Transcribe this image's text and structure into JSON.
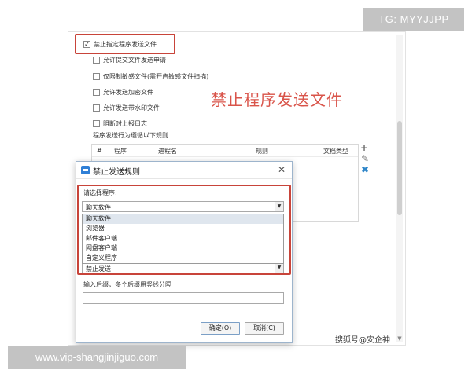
{
  "watermarks": {
    "tg": "TG: MYYJJPP",
    "site": "www.vip-shangjinjiguo.com",
    "source": "搜狐号@安企神"
  },
  "settings": {
    "main_checkbox": {
      "label": "禁止指定程序发送文件",
      "checked": true
    },
    "options": [
      {
        "label": "允许提交文件发送申请",
        "checked": false
      },
      {
        "label": "仅限制敏感文件(需开启敏感文件扫描)",
        "checked": false
      },
      {
        "label": "允许发送加密文件",
        "checked": false
      },
      {
        "label": "允许发送带水印文件",
        "checked": false
      },
      {
        "label": "阻断时上报日志",
        "checked": false
      }
    ],
    "rules_caption": "程序发送行为遵循以下规则",
    "table_headers": [
      "#",
      "程序",
      "进程名",
      "规则",
      "文档类型"
    ]
  },
  "annotation": "禁止程序发送文件",
  "icons": {
    "add": "plus-icon",
    "edit": "pencil-icon",
    "delete": "x-icon"
  },
  "colors": {
    "highlight": "#c8443a",
    "annotation": "#d9544a",
    "delete": "#2f86c9"
  },
  "dialog": {
    "title": "禁止发送规则",
    "program_label": "请选择程序:",
    "program_selected": "聊天软件",
    "program_options": [
      "聊天软件",
      "浏览器",
      "邮件客户端",
      "网盘客户端",
      "自定义程序"
    ],
    "rule_selected": "禁止发送",
    "ext_label": "输入后缀，多个后缀用竖线分隔",
    "ext_value": "",
    "ok_label": "确定(O)",
    "cancel_label": "取消(C)"
  }
}
